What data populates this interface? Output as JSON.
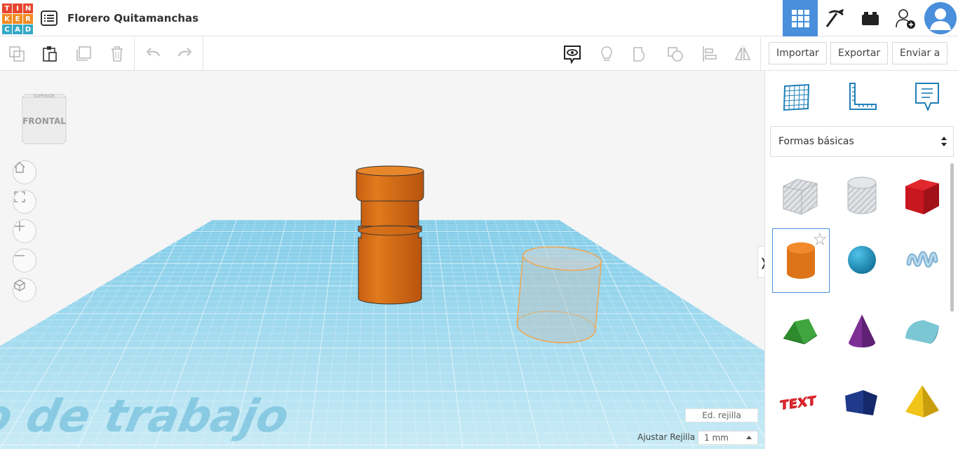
{
  "app": {
    "logo_letters": [
      "T",
      "I",
      "N",
      "K",
      "E",
      "R",
      "C",
      "A",
      "D"
    ],
    "logo_colors": [
      "#e7462e",
      "#e7462e",
      "#e7462e",
      "#f28b22",
      "#f28b22",
      "#f28b22",
      "#36a9c8",
      "#36a9c8",
      "#36a9c8"
    ],
    "design_title": "Florero Quitamanchas",
    "accent_color": "#4a8fdb"
  },
  "header": {
    "icons": [
      "grid-view-icon",
      "pickaxe-icon",
      "bricks-icon",
      "add-user-icon",
      "avatar"
    ]
  },
  "toolbar": {
    "import_label": "Importar",
    "export_label": "Exportar",
    "send_label": "Enviar a"
  },
  "viewport": {
    "viewcube_label": "FRONTAL",
    "viewcube_top_label": "SUPERIOR",
    "workplane_watermark": "Plano de trabajo",
    "edit_grid_label": "Ed. rejilla",
    "snap_grid_label": "Ajustar Rejilla",
    "snap_grid_value": "1 mm"
  },
  "panel": {
    "shape_library": "Formas básicas",
    "shapes": [
      "box-hole",
      "cylinder-hole",
      "box",
      "cylinder",
      "sphere",
      "scribble",
      "roof",
      "cone",
      "round-roof",
      "text",
      "prism",
      "pyramid"
    ],
    "selected_shape": "cylinder"
  }
}
